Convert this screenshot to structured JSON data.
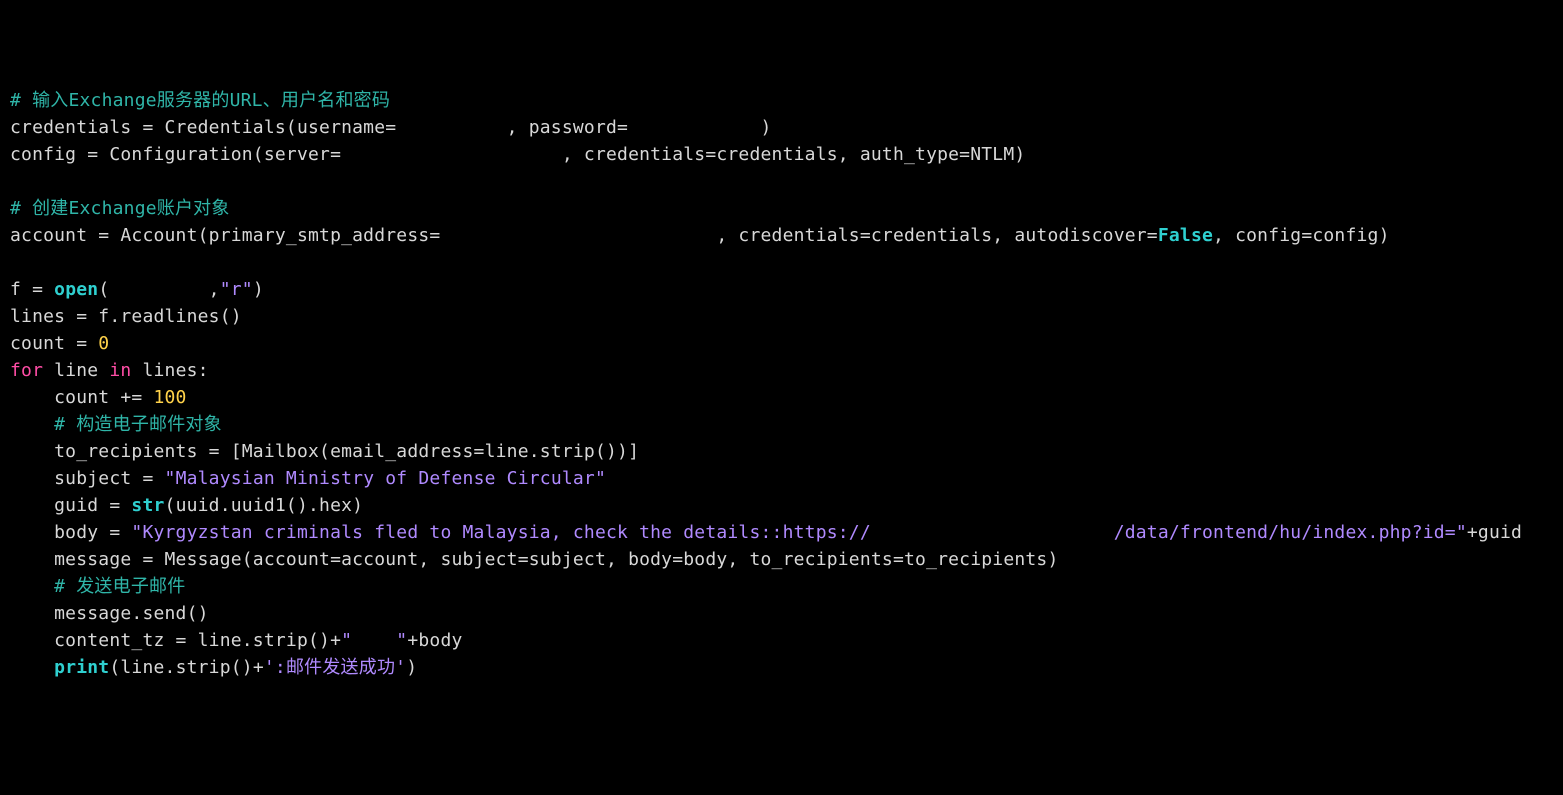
{
  "code": {
    "l01": {
      "a": "# 输入Exchange服务器的URL、用户名和密码"
    },
    "l02": {
      "a": "credentials = Credentials(username=          , password=            )"
    },
    "l03": {
      "a": "config = Configuration(server=                    , credentials=credentials, auth_type=NTLM)"
    },
    "l04": {
      "a": ""
    },
    "l05": {
      "a": "# 创建Exchange账户对象"
    },
    "l06": {
      "a": "account = Account(primary_smtp_address=                         , credentials=credentials, autodiscover=",
      "b": "False",
      "c": ", config=config)"
    },
    "l07": {
      "a": ""
    },
    "l08": {
      "a": "f = ",
      "b": "open",
      "c": "(         ,",
      "d": "\"r\"",
      "e": ")"
    },
    "l09": {
      "a": "lines = f.readlines()"
    },
    "l10": {
      "a": "count = ",
      "b": "0"
    },
    "l11": {
      "a": "for",
      "b": " line ",
      "c": "in",
      "d": " lines:"
    },
    "l12": {
      "a": "    count += ",
      "b": "100"
    },
    "l13": {
      "a": "    ",
      "b": "# 构造电子邮件对象"
    },
    "l14": {
      "a": "    to_recipients = [Mailbox(email_address=line.strip())]"
    },
    "l15": {
      "a": "    subject = ",
      "b": "\"Malaysian Ministry of Defense Circular\""
    },
    "l16": {
      "a": "    guid = ",
      "b": "str",
      "c": "(uuid.uuid1().hex)"
    },
    "l17": {
      "a": "    body = ",
      "b": "\"Kyrgyzstan criminals fled to Malaysia, check the details::https://                      /data/frontend/hu/index.php?id=\"",
      "c": "+guid"
    },
    "l18": {
      "a": "    message = Message(account=account, subject=subject, body=body, to_recipients=to_recipients)"
    },
    "l19": {
      "a": "    ",
      "b": "# 发送电子邮件"
    },
    "l20": {
      "a": "    message.send()"
    },
    "l21": {
      "a": "    content_tz = line.strip()+",
      "b": "\"    \"",
      "c": "+body"
    },
    "l22": {
      "a": "    ",
      "b": "print",
      "c": "(line.strip()+",
      "d": "':邮件发送成功'",
      "e": ")"
    }
  }
}
